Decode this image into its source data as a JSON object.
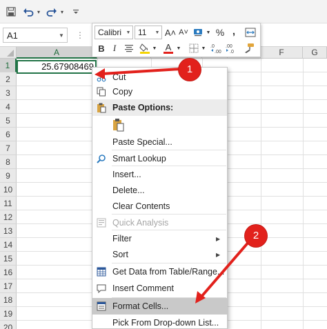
{
  "quick_access": {
    "save_icon": "save-icon",
    "undo_icon": "undo-icon",
    "redo_icon": "redo-icon",
    "customize_icon": "customize-qat-icon"
  },
  "name_box": {
    "value": "A1"
  },
  "formula_bar": {
    "dots": "⋮"
  },
  "columns": [
    "A",
    "F",
    "G"
  ],
  "rows": [
    "1",
    "2",
    "3",
    "4",
    "5",
    "6",
    "7",
    "8",
    "9",
    "10",
    "11",
    "12",
    "13",
    "14",
    "15",
    "16",
    "17",
    "18",
    "19",
    "20"
  ],
  "active_cell": {
    "value": "25.67908469"
  },
  "mini_toolbar": {
    "font_name": "Calibri",
    "font_size": "11",
    "grow_font": "A˄",
    "shrink_font": "A˅",
    "percent": "%",
    "comma": ",",
    "bold": "B",
    "italic": "I",
    "font_color_letter": "A",
    "font_color": "#e2211c",
    "fill_color": "#f5d400",
    "increase_decimal": ".0←",
    "decrease_decimal": ".00→"
  },
  "context_menu": {
    "items": [
      {
        "label": "Cut"
      },
      {
        "label": "Copy"
      },
      {
        "label": "Paste Options:"
      },
      {
        "label": "Paste Special..."
      },
      {
        "label": "Smart Lookup"
      },
      {
        "label": "Insert..."
      },
      {
        "label": "Delete..."
      },
      {
        "label": "Clear Contents"
      },
      {
        "label": "Quick Analysis"
      },
      {
        "label": "Filter"
      },
      {
        "label": "Sort"
      },
      {
        "label": "Get Data from Table/Range..."
      },
      {
        "label": "Insert Comment"
      },
      {
        "label": "Format Cells..."
      },
      {
        "label": "Pick From Drop-down List..."
      }
    ]
  },
  "annotations": {
    "badge1": "1",
    "badge2": "2",
    "color": "#e2211c"
  }
}
